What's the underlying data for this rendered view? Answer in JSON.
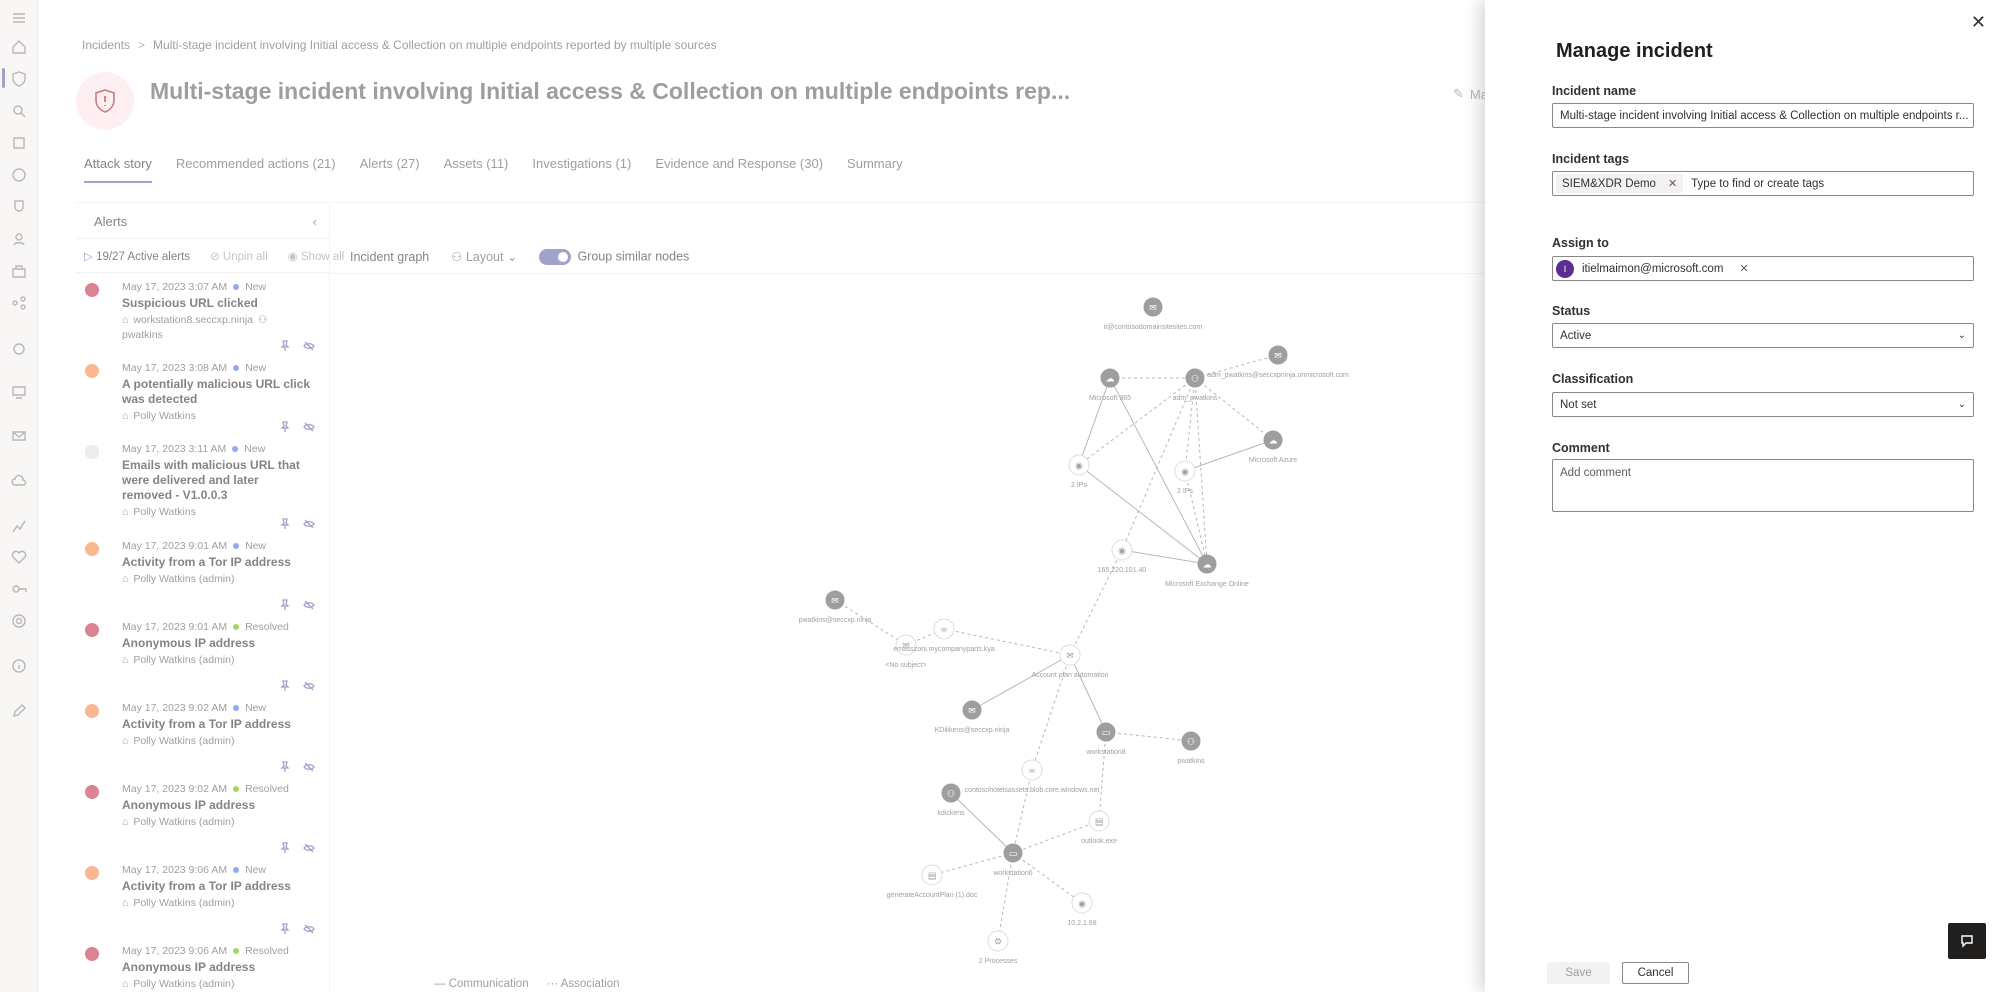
{
  "breadcrumb": {
    "root": "Incidents",
    "separator": ">",
    "current": "Multi-stage incident involving Initial access & Collection on multiple endpoints reported by multiple sources"
  },
  "header": {
    "title": "Multi-stage incident involving Initial access & Collection on multiple endpoints rep...",
    "manage_label": "Ma"
  },
  "tabs": [
    {
      "label": "Attack story",
      "selected": true
    },
    {
      "label": "Recommended actions (21)"
    },
    {
      "label": "Alerts (27)"
    },
    {
      "label": "Assets (11)"
    },
    {
      "label": "Investigations (1)"
    },
    {
      "label": "Evidence and Response (30)"
    },
    {
      "label": "Summary"
    }
  ],
  "alerts_pane": {
    "title": "Alerts",
    "active_count": "19/27 Active alerts",
    "unpin_all": "Unpin all",
    "show_all": "Show all",
    "items": [
      {
        "time": "May 17, 2023 3:07 AM",
        "status": "New",
        "name": "Suspicious URL clicked",
        "entity": "workstation8.seccxp.ninja",
        "entity2": "pwatkins",
        "severity": "high"
      },
      {
        "time": "May 17, 2023 3:08 AM",
        "status": "New",
        "name": "A potentially malicious URL click was detected",
        "entity": "Polly Watkins",
        "severity": "medium"
      },
      {
        "time": "May 17, 2023 3:11 AM",
        "status": "New",
        "name": "Emails with malicious URL that were delivered and later removed - V1.0.0.3",
        "entity": "Polly Watkins",
        "severity": "info"
      },
      {
        "time": "May 17, 2023 9:01 AM",
        "status": "New",
        "name": "Activity from a Tor IP address",
        "entity": "Polly Watkins (admin)",
        "severity": "medium"
      },
      {
        "time": "May 17, 2023 9:01 AM",
        "status": "Resolved",
        "name": "Anonymous IP address",
        "entity": "Polly Watkins (admin)",
        "severity": "high"
      },
      {
        "time": "May 17, 2023 9:02 AM",
        "status": "New",
        "name": "Activity from a Tor IP address",
        "entity": "Polly Watkins (admin)",
        "severity": "medium"
      },
      {
        "time": "May 17, 2023 9:02 AM",
        "status": "Resolved",
        "name": "Anonymous IP address",
        "entity": "Polly Watkins (admin)",
        "severity": "high"
      },
      {
        "time": "May 17, 2023 9:06 AM",
        "status": "New",
        "name": "Activity from a Tor IP address",
        "entity": "Polly Watkins (admin)",
        "severity": "medium"
      },
      {
        "time": "May 17, 2023 9:06 AM",
        "status": "Resolved",
        "name": "Anonymous IP address",
        "entity": "Polly Watkins (admin)",
        "severity": "high"
      }
    ]
  },
  "graph_toolbar": {
    "title": "Incident graph",
    "layout": "Layout",
    "group_label": "Group similar nodes",
    "group_enabled": true
  },
  "graph_nodes": {
    "n1": "it@contosodomainsitesites.com",
    "n2": "Microsoft 365",
    "n3": "adm_pwatkins",
    "n4": "adm_pwatkins@seccxpninja.onmicrosoft.com",
    "n5": "Microsoft Azure",
    "n6": "2 IPs",
    "n7": "2 IPs",
    "n8": "165.220.101.40",
    "n9": "Microsoft Exchange Online",
    "n10": "pwatkins@seccxp.ninja",
    "n11": "<No subject>",
    "n12": "emasszoni.mycompanyparts.kya",
    "n13": "Account plan automation",
    "n14": "KDilikens@seccxp.ninja",
    "n15": "workstation8",
    "n16": "pwatkins",
    "n17": "contosohotelsassets.blob.core.windows.net",
    "n18": "kdickens",
    "n19": "outlook.exe",
    "n20": "workstation6",
    "n21": "generateAccountPlan (1).doc",
    "n22": "10.2.1.68",
    "n23": "2 Processes"
  },
  "legend": {
    "communication": "Communication",
    "association": "Association"
  },
  "manage_panel": {
    "title": "Manage incident",
    "name_label": "Incident name",
    "name_value": "Multi-stage incident involving Initial access & Collection on multiple endpoints r...",
    "tags_label": "Incident tags",
    "tag": "SIEM&XDR Demo",
    "tags_placeholder": "Type to find or create tags",
    "assign_label": "Assign to",
    "assignee_initial": "I",
    "assignee": "itielmaimon@microsoft.com",
    "status_label": "Status",
    "status_value": "Active",
    "class_label": "Classification",
    "class_value": "Not set",
    "comment_label": "Comment",
    "comment_placeholder": "Add comment",
    "save": "Save",
    "cancel": "Cancel"
  },
  "colors": {
    "high": "#c4314b",
    "medium": "#f7894a",
    "info": "#e1dfdd",
    "accent": "#6264a7",
    "status_new": "#4f6bed",
    "status_resolved": "#6bb700"
  }
}
